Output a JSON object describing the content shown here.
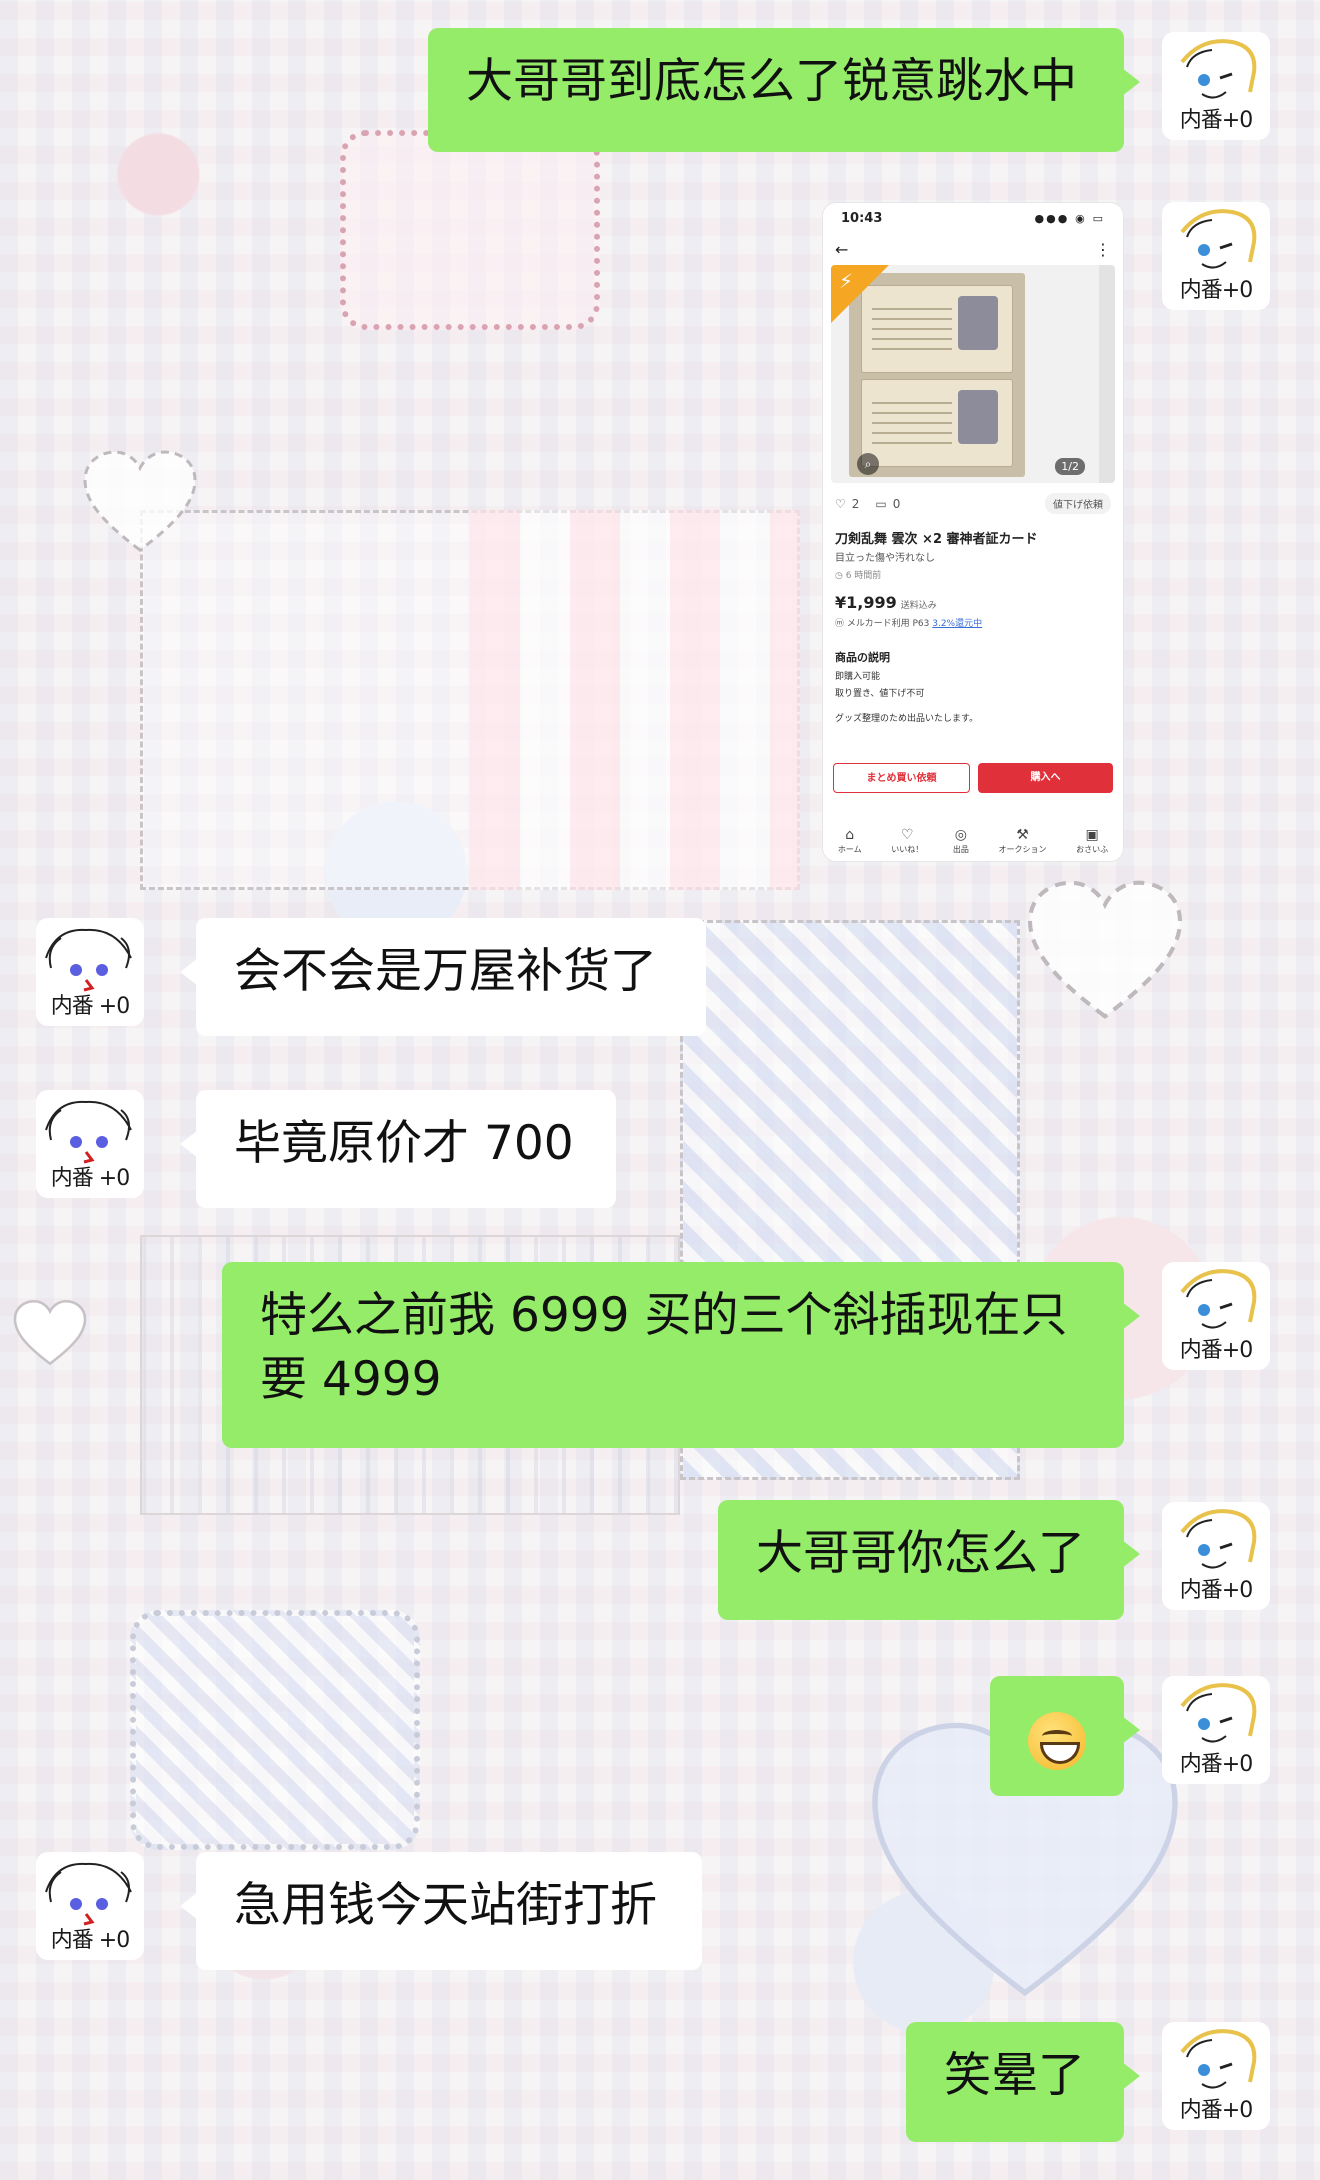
{
  "chat": {
    "messages": [
      {
        "side": "right",
        "type": "text",
        "text": "大哥哥到底怎么了锐意跳水中"
      },
      {
        "side": "right",
        "type": "image"
      },
      {
        "side": "left",
        "type": "text",
        "text": "会不会是万屋补货了"
      },
      {
        "side": "left",
        "type": "text",
        "text": "毕竟原价才 700"
      },
      {
        "side": "right",
        "type": "text",
        "text": "特么之前我 6999 买的三个斜插现在只要 4999"
      },
      {
        "side": "right",
        "type": "text",
        "text": "大哥哥你怎么了"
      },
      {
        "side": "right",
        "type": "emoji",
        "icon": "grinning-face-emoji"
      },
      {
        "side": "left",
        "type": "text",
        "text": "急用钱今天站街打折"
      },
      {
        "side": "right",
        "type": "text",
        "text": "笑晕了"
      }
    ],
    "avatars": {
      "self_tag": "内番+0",
      "other_tag": "内番 +0"
    }
  },
  "screenshot": {
    "status_time": "10:43",
    "status_icons": "●●● ◉ ▭",
    "image_counter": "1/2",
    "likes": "2",
    "comments": "0",
    "price_down_label": "値下げ依頼",
    "title": "刀剣乱舞 雲次 ×2 審神者証カード",
    "condition": "目立った傷や汚れなし",
    "posted": "6 時間前",
    "price": "¥1,999",
    "tax_note": "送料込み",
    "card_note": "メルカード利用 P63",
    "rebate": "3.2%還元中",
    "desc_heading": "商品の説明",
    "desc_lines": [
      "即購入可能",
      "取り置き、値下げ不可",
      "",
      "グッズ整理のため出品いたします。"
    ],
    "btn_bundle": "まとめ買い依頼",
    "btn_buy": "購入へ",
    "tabs": [
      "ホーム",
      "いいね！",
      "出品",
      "オークション",
      "おさいふ"
    ]
  },
  "colors": {
    "green_bubble": "#95ec69",
    "white_bubble": "#ffffff",
    "buy_red": "#e0303a"
  }
}
